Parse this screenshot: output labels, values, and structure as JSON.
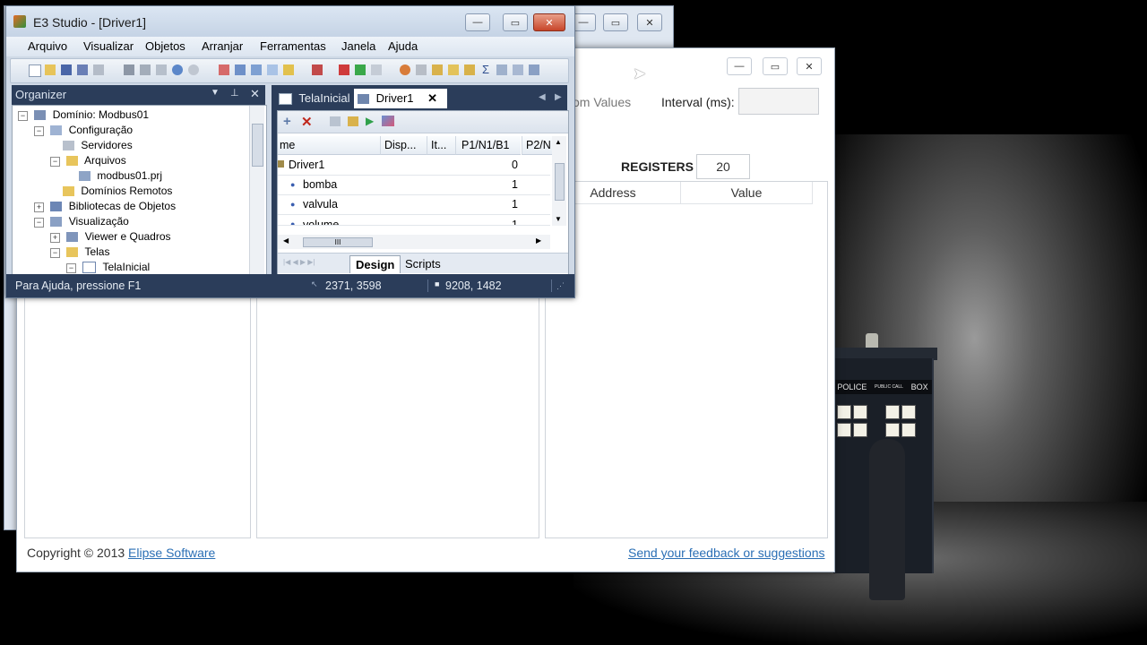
{
  "e3": {
    "title": "E3 Studio - [Driver1]",
    "menu": [
      "Arquivo",
      "Visualizar",
      "Objetos",
      "Arranjar",
      "Ferramentas",
      "Janela",
      "Ajuda"
    ],
    "organizer": {
      "title": "Organizer",
      "tree": [
        {
          "label": "Domínio: Modbus01",
          "level": 0,
          "toggle": "−",
          "icon": "domain-icon"
        },
        {
          "label": "Configuração",
          "level": 1,
          "toggle": "−",
          "icon": "config-icon"
        },
        {
          "label": "Servidores",
          "level": 2,
          "toggle": "",
          "icon": "servers-icon"
        },
        {
          "label": "Arquivos",
          "level": 2,
          "toggle": "−",
          "icon": "folder-icon"
        },
        {
          "label": "modbus01.prj",
          "level": 3,
          "toggle": "",
          "icon": "project-file-icon"
        },
        {
          "label": "Domínios Remotos",
          "level": 2,
          "toggle": "",
          "icon": "folder-icon"
        },
        {
          "label": "Bibliotecas de Objetos",
          "level": 1,
          "toggle": "+",
          "icon": "library-icon"
        },
        {
          "label": "Visualização",
          "level": 1,
          "toggle": "−",
          "icon": "visualization-icon"
        },
        {
          "label": "Viewer e Quadros",
          "level": 2,
          "toggle": "+",
          "icon": "viewer-icon"
        },
        {
          "label": "Telas",
          "level": 2,
          "toggle": "−",
          "icon": "folder-icon"
        },
        {
          "label": "TelaInicial",
          "level": 3,
          "toggle": "−",
          "icon": "screen-icon"
        }
      ]
    },
    "tabs": [
      {
        "label": "TelaInicial",
        "active": false
      },
      {
        "label": "Driver1",
        "active": true
      }
    ],
    "grid": {
      "columns": [
        "me",
        "Disp...",
        "It...",
        "P1/N1/B1",
        "P2/N"
      ],
      "rows": [
        {
          "name": "Driver1",
          "p1": "0"
        },
        {
          "name": "bomba",
          "p1": "1"
        },
        {
          "name": "valvula",
          "p1": "1"
        },
        {
          "name": "volume",
          "p1": "1"
        }
      ],
      "scroll_thumb": "III",
      "view_tabs": [
        "Design",
        "Scripts"
      ]
    },
    "status": {
      "help": "Para Ajuda, pressione F1",
      "coords": "2371, 3598",
      "size": "9208, 1482"
    }
  },
  "modbus_app": {
    "random_values_label": "om Values",
    "interval_label": "Interval (ms):",
    "interval_value": "",
    "registers_label": "REGISTERS",
    "registers_value": "20",
    "columns": [
      "Address",
      "Value"
    ],
    "copyright": "Copyright © 2013",
    "copyright_link": "Elipse Software",
    "feedback_link": "Send your feedback or suggestions"
  },
  "wallpaper": {
    "sign_left": "POLICE",
    "sign_mid": "PUBLIC CALL",
    "sign_right": "BOX"
  }
}
